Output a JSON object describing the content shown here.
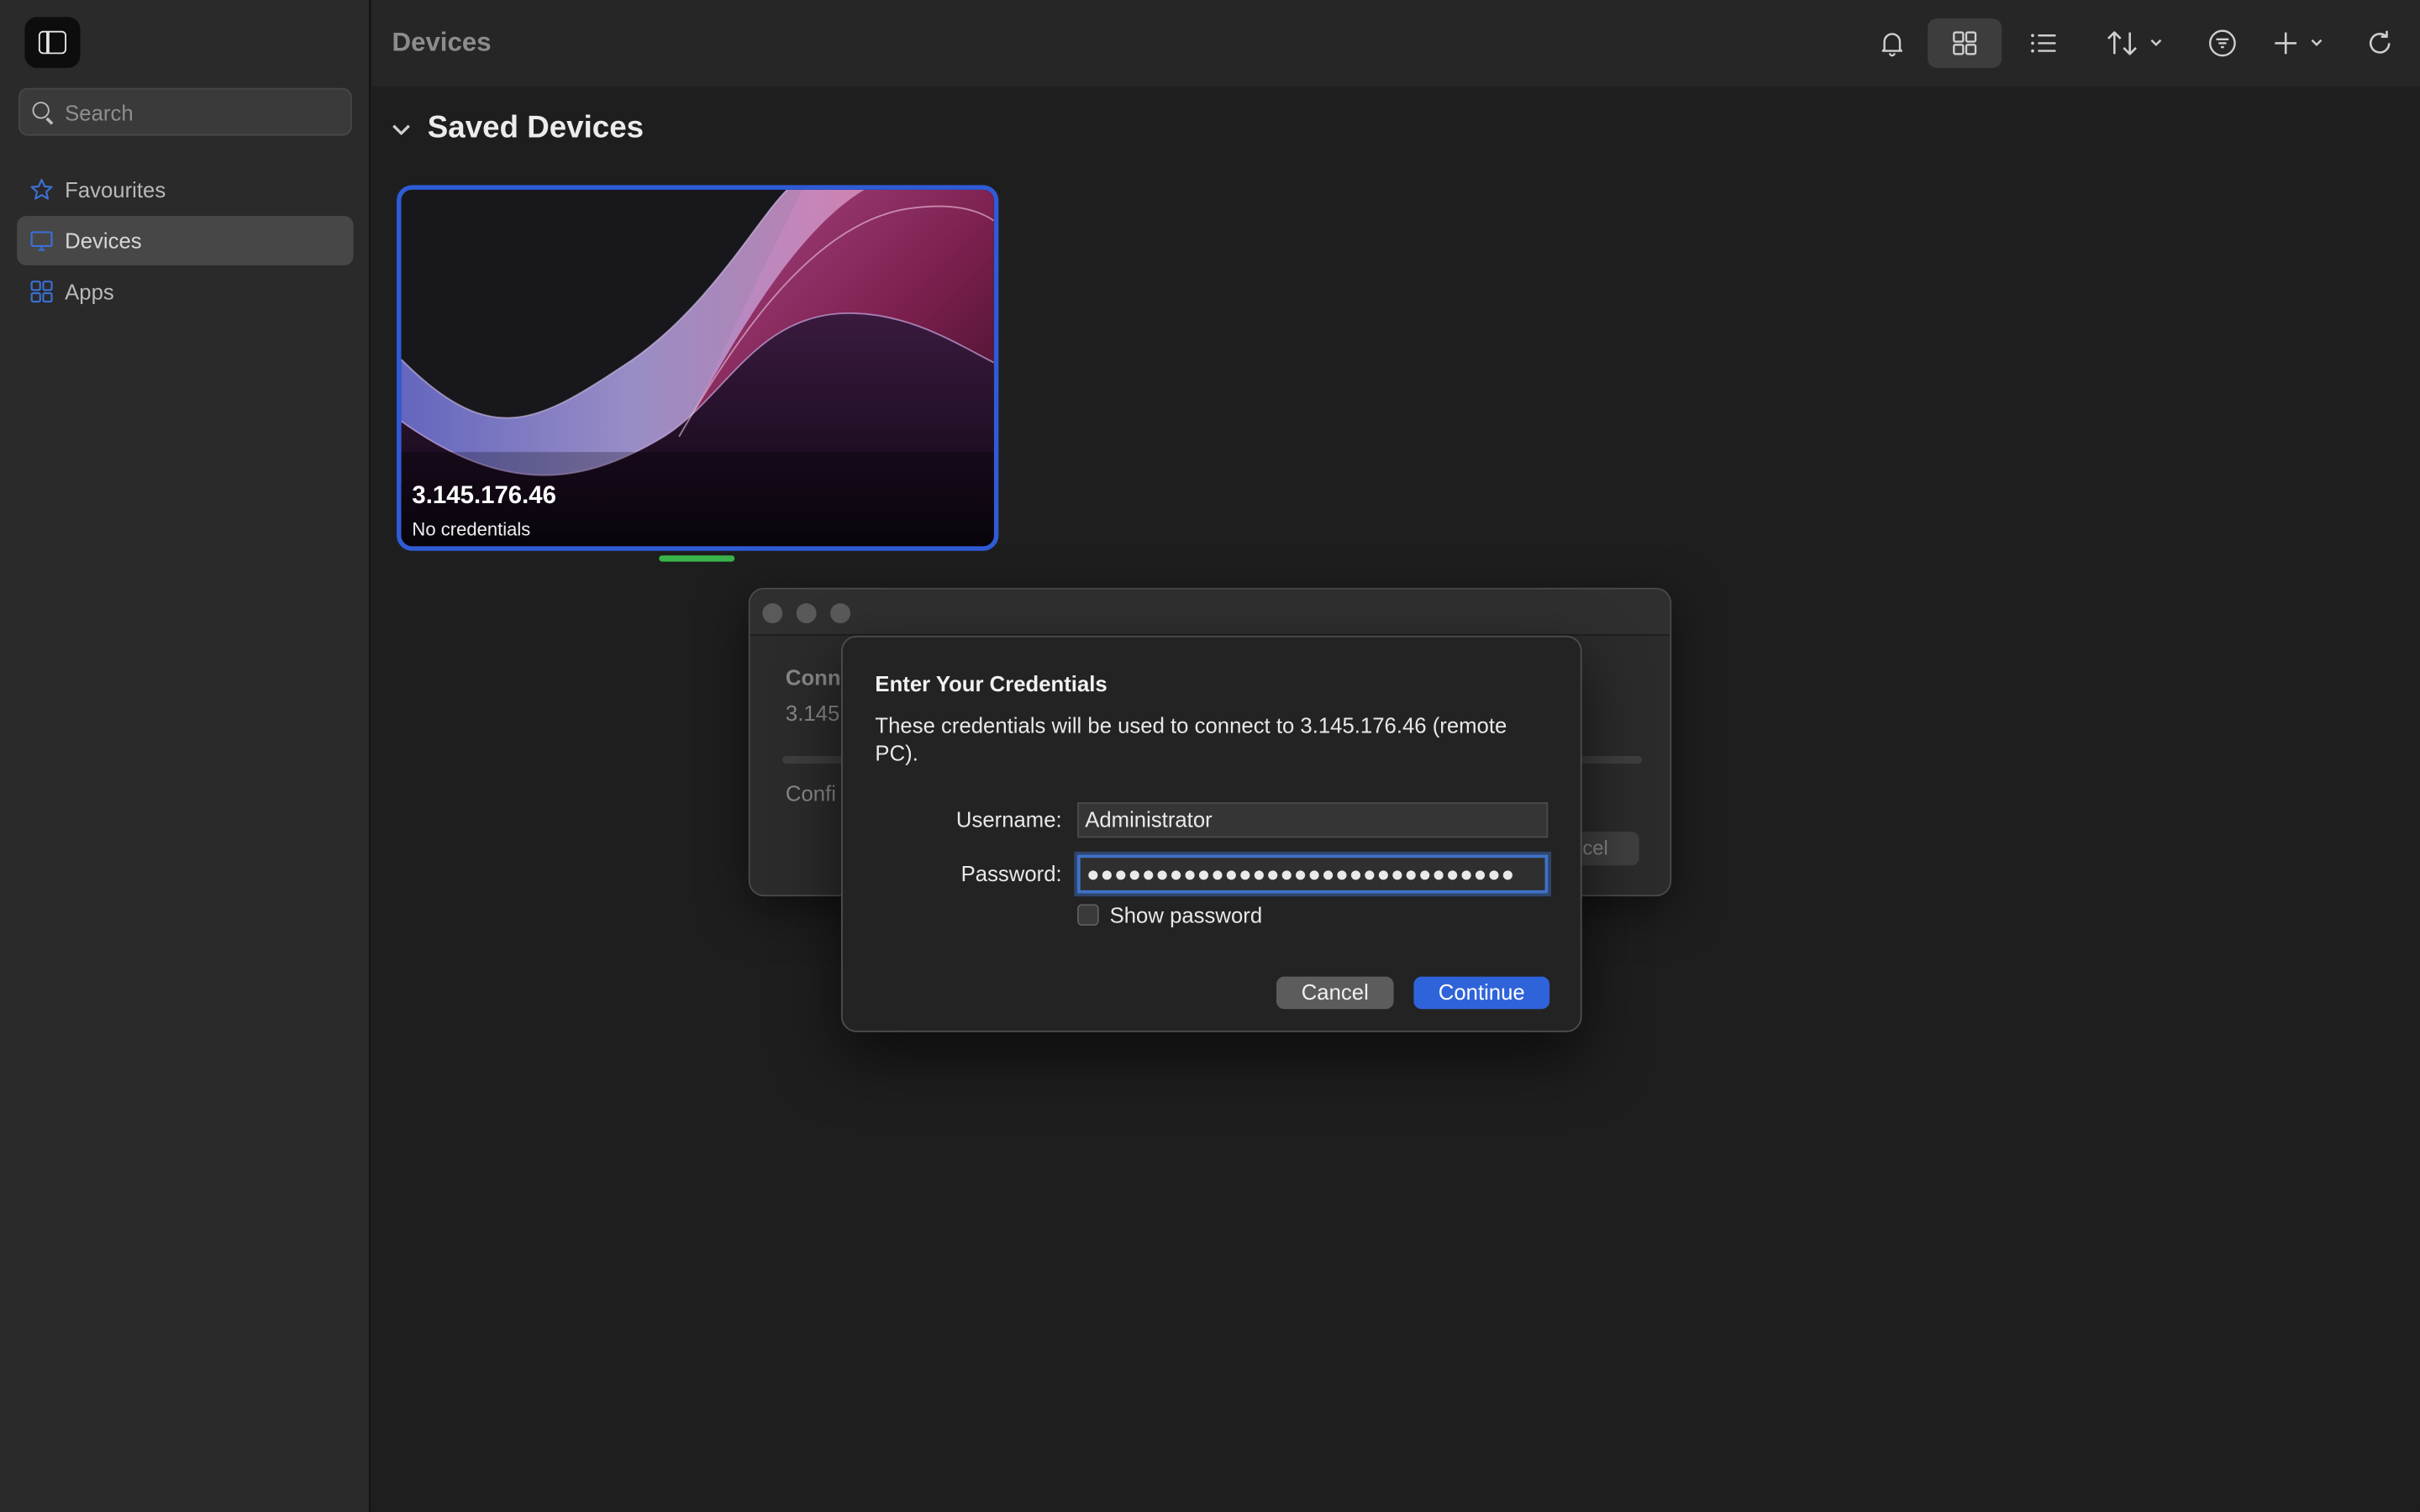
{
  "sidebar": {
    "search_placeholder": "Search",
    "items": [
      {
        "label": "Favourites",
        "icon": "star-icon"
      },
      {
        "label": "Devices",
        "icon": "monitor-icon"
      },
      {
        "label": "Apps",
        "icon": "apps-grid-icon"
      }
    ]
  },
  "toolbar": {
    "title": "Devices",
    "icons": [
      "bell-icon",
      "grid-view-icon",
      "list-view-icon",
      "sort-icon",
      "filter-icon",
      "add-icon",
      "refresh-icon"
    ]
  },
  "section": {
    "title": "Saved Devices"
  },
  "device": {
    "ip": "3.145.176.46",
    "status": "No credentials"
  },
  "connection_window": {
    "title": "Conn",
    "subtitle": "3.145",
    "status": "Confi",
    "cancel": "cel"
  },
  "credentials_dialog": {
    "title": "Enter Your Credentials",
    "description": "These credentials will be used to connect to 3.145.176.46 (remote PC).",
    "username_label": "Username:",
    "username_value": "Administrator",
    "password_label": "Password:",
    "password_value": "●●●●●●●●●●●●●●●●●●●●●●●●●●●●●●●",
    "show_password_label": "Show password",
    "cancel_label": "Cancel",
    "continue_label": "Continue"
  },
  "colors": {
    "accent": "#2f63d9",
    "selection_border": "#2f5bd6",
    "indicator": "#39b54a"
  }
}
